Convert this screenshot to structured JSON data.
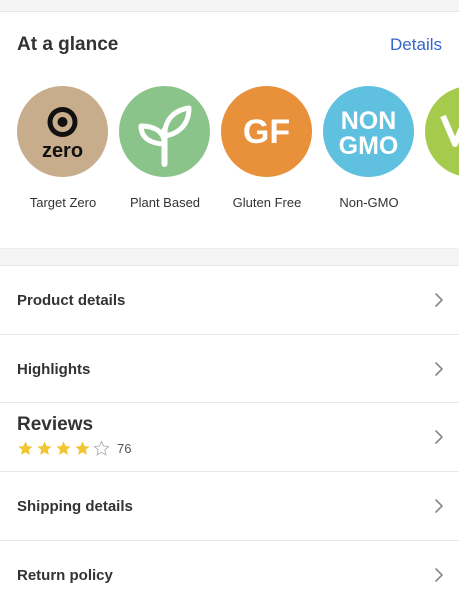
{
  "glance": {
    "title": "At a glance",
    "details_link": "Details",
    "badges": [
      {
        "label": "Target Zero",
        "icon": "target-zero-logo",
        "color": "#c8ad8c",
        "text": "zero"
      },
      {
        "label": "Plant Based",
        "icon": "sprout-icon",
        "color": "#8bc48a"
      },
      {
        "label": "Gluten Free",
        "icon": "gluten-free-icon",
        "color": "#e8913a",
        "text": "GF"
      },
      {
        "label": "Non-GMO",
        "icon": "non-gmo-icon",
        "color": "#5fc0df",
        "text_line1": "NON",
        "text_line2": "GMO"
      },
      {
        "label": "V",
        "icon": "vegan-icon",
        "color": "#a6cb4c"
      }
    ]
  },
  "rows": {
    "product_details": "Product details",
    "highlights": "Highlights",
    "reviews": "Reviews",
    "shipping_details": "Shipping details",
    "return_policy": "Return policy"
  },
  "reviews": {
    "rating": 4,
    "max_rating": 5,
    "count": "76",
    "star_color": "#f2c531"
  },
  "colors": {
    "accent_link": "#3366cc",
    "chevron": "#888888"
  }
}
